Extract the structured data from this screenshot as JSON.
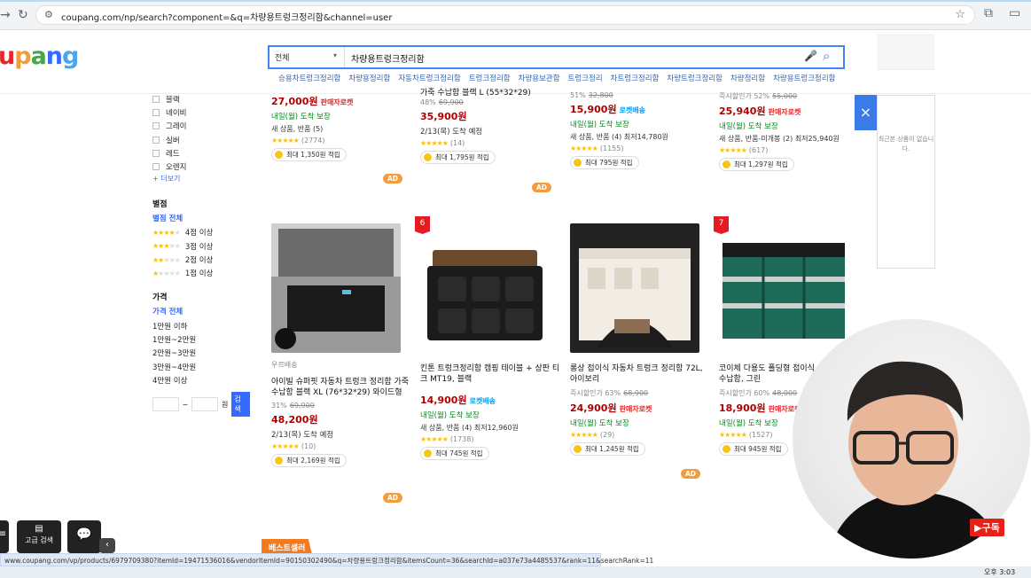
{
  "browser": {
    "url": "coupang.com/np/search?component=&q=차량용트렁크정리함&channel=user"
  },
  "header": {
    "logo": "upang",
    "category": "전체",
    "query": "차량용트렁크정리함",
    "related": [
      "승용차트렁크정리함",
      "차량용정리함",
      "자동차트렁크정리함",
      "트렁크정리함",
      "차량용보관함",
      "트렁크정리",
      "차트렁크정리함",
      "차량트렁크정리함",
      "차량정리함",
      "차량용트렁크정리함"
    ]
  },
  "sidebar": {
    "colors": [
      "블랙",
      "네이비",
      "그레이",
      "실버",
      "레드",
      "오렌지"
    ],
    "more": "+ 더보기",
    "rating_title": "별점",
    "rating_all": "별점 전체",
    "ratings": [
      {
        "label": "4점 이상",
        "stars": 4
      },
      {
        "label": "3점 이상",
        "stars": 3
      },
      {
        "label": "2점 이상",
        "stars": 2
      },
      {
        "label": "1점 이상",
        "stars": 1
      }
    ],
    "price_title": "가격",
    "price_all": "가격 전체",
    "prices": [
      "1만원 이하",
      "1만원~2만원",
      "2만원~3만원",
      "3만원~4만원",
      "4만원 이상"
    ],
    "range_sep": "~",
    "range_unit": "원",
    "range_btn": "검색"
  },
  "top_products": [
    {
      "price": "27,000원",
      "rocket": "판매자로켓",
      "deliv": "내일(월) 도착 보장",
      "rev": "새 상품, 반품 (5)",
      "count": "(2774)",
      "reward": "최대 1,350원 적립"
    },
    {
      "name": "가죽 수납함 블랙 L (55*32*29)",
      "disc": "48%",
      "orig": "69,900",
      "price": "35,900원",
      "deliv": "2/13(목) 도착 예정",
      "count": "(14)",
      "reward": "최대 1,795원 적립",
      "ad": "AD"
    },
    {
      "disc": "51%",
      "orig": "32,800",
      "price": "15,900원",
      "rocket": "로켓배송",
      "deliv": "내일(월) 도착 보장",
      "rev": "새 상품, 반품 (4) 최저14,780원",
      "count": "(1155)",
      "reward": "최대 795원 적립"
    },
    {
      "disc": "즉시할인가 52%",
      "orig": "55,000",
      "price": "25,940원",
      "rocket": "판매자로켓",
      "deliv": "내일(월) 도착 보장",
      "rev": "새 상품, 반품-미개봉 (2) 최저25,940원",
      "count": "(617)",
      "reward": "최대 1,297원 적립"
    }
  ],
  "products": [
    {
      "seller": "우르배송",
      "name": "아이빌 슈퍼핏 자동차 트렁크 정리함 가죽 수납함 블랙 XL (76*32*29) 와이드형",
      "disc": "31%",
      "orig": "69,900",
      "price": "48,200원",
      "deliv": "2/13(목) 도착 예정",
      "count": "(10)",
      "reward": "최대 2,169원 적립",
      "ad": "AD"
    },
    {
      "rank": "6",
      "name": "킨톤 트렁크정리함 캠핑 테이블 + 상판 티크 MT19, 블랙",
      "price": "14,900원",
      "rocket": "로켓배송",
      "deliv": "내일(월) 도착 보장",
      "rev": "새 상품, 반품 (4) 최저12,960원",
      "count": "(1738)",
      "reward": "최대 745원 적립"
    },
    {
      "name": "롱상 접이식 자동차 트렁크 정리함 72L, 아이보리",
      "disc": "즉시할인가 63%",
      "orig": "68,900",
      "price": "24,900원",
      "rocket": "판매자로켓",
      "deliv": "내일(월) 도착 보장",
      "count": "(29)",
      "reward": "최대 1,245원 적립",
      "ad": "AD"
    },
    {
      "rank": "7",
      "name": "코이체 다용도 폴딩형 접이식 트렁크 정리 수납함, 그린",
      "disc": "즉시할인가 60%",
      "orig": "48,000",
      "price": "18,900원",
      "rocket": "판매자로켓",
      "deliv": "내일(월) 도착 보장",
      "count": "(1527)",
      "reward": "최대 945원 적립"
    }
  ],
  "floating": {
    "close": "×",
    "recent": "최근본 상품이 없습니다."
  },
  "bottom": {
    "adv_search": "고급 검색",
    "bestseller": "베스트셀러",
    "subscribe": "▶구독",
    "clock": "오후 3:03"
  },
  "statusbar": "www.coupang.com/vp/products/6979709380?itemId=19471536016&vendorItemId=90150302490&q=차량용트렁크정리함&itemsCount=36&searchId=a037e73a4485537&rank=11&searchRank=11",
  "colors": {
    "coupang_blue": "#346aff",
    "price_red": "#ae0000",
    "rocket_red": "#e52528",
    "green": "#00891a"
  }
}
